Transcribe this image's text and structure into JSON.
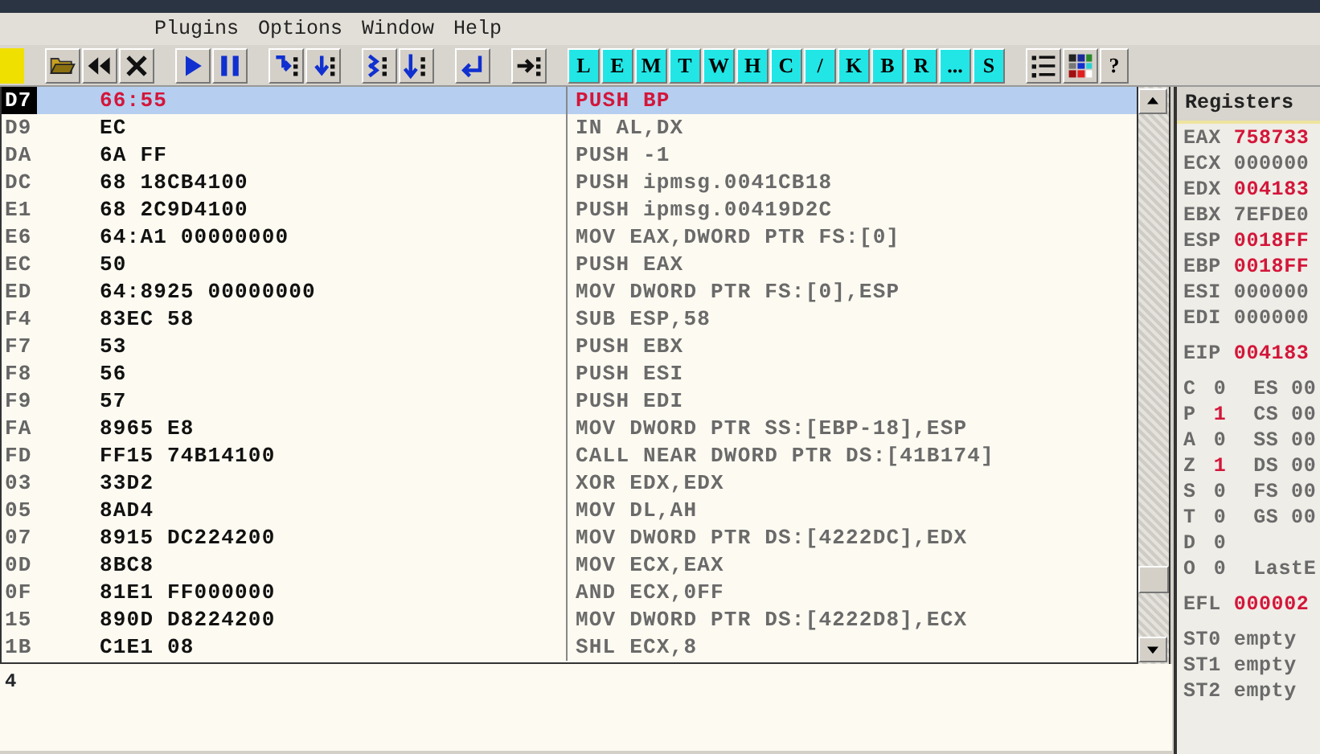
{
  "menu": [
    {
      "label": "Plugins"
    },
    {
      "label": "Options"
    },
    {
      "label": "Window"
    },
    {
      "label": "Help"
    }
  ],
  "toolbar": [
    {
      "kind": "marker"
    },
    {
      "kind": "gap"
    },
    {
      "kind": "folder"
    },
    {
      "kind": "rewind"
    },
    {
      "kind": "close"
    },
    {
      "kind": "gap"
    },
    {
      "kind": "play"
    },
    {
      "kind": "pause"
    },
    {
      "kind": "gap"
    },
    {
      "kind": "stepin"
    },
    {
      "kind": "stepover"
    },
    {
      "kind": "gap"
    },
    {
      "kind": "tracein"
    },
    {
      "kind": "traceover"
    },
    {
      "kind": "gap"
    },
    {
      "kind": "ret"
    },
    {
      "kind": "gap"
    },
    {
      "kind": "goto"
    },
    {
      "kind": "gap"
    },
    {
      "kind": "letter",
      "label": "L"
    },
    {
      "kind": "letter",
      "label": "E"
    },
    {
      "kind": "letter",
      "label": "M"
    },
    {
      "kind": "letter",
      "label": "T"
    },
    {
      "kind": "letter",
      "label": "W"
    },
    {
      "kind": "letter",
      "label": "H"
    },
    {
      "kind": "letter",
      "label": "C"
    },
    {
      "kind": "letter",
      "label": "/"
    },
    {
      "kind": "letter",
      "label": "K"
    },
    {
      "kind": "letter",
      "label": "B"
    },
    {
      "kind": "letter",
      "label": "R"
    },
    {
      "kind": "letter",
      "label": "..."
    },
    {
      "kind": "letter",
      "label": "S"
    },
    {
      "kind": "gap"
    },
    {
      "kind": "list"
    },
    {
      "kind": "palette"
    },
    {
      "kind": "text",
      "label": "?"
    }
  ],
  "disassembly": {
    "rows": [
      {
        "address": "D7",
        "hex": "66:55",
        "instruction": "PUSH BP",
        "selected": true,
        "modified": true
      },
      {
        "address": "D9",
        "hex": "EC",
        "instruction": "IN AL,DX",
        "selected": false,
        "modified": false
      },
      {
        "address": "DA",
        "hex": "6A FF",
        "instruction": "PUSH -1",
        "selected": false,
        "modified": false
      },
      {
        "address": "DC",
        "hex": "68 18CB4100",
        "instruction": "PUSH ipmsg.0041CB18",
        "selected": false,
        "modified": false
      },
      {
        "address": "E1",
        "hex": "68 2C9D4100",
        "instruction": "PUSH ipmsg.00419D2C",
        "selected": false,
        "modified": false
      },
      {
        "address": "E6",
        "hex": "64:A1 00000000",
        "instruction": "MOV EAX,DWORD PTR FS:[0]",
        "selected": false,
        "modified": false
      },
      {
        "address": "EC",
        "hex": "50",
        "instruction": "PUSH EAX",
        "selected": false,
        "modified": false
      },
      {
        "address": "ED",
        "hex": "64:8925 00000000",
        "instruction": "MOV DWORD PTR FS:[0],ESP",
        "selected": false,
        "modified": false
      },
      {
        "address": "F4",
        "hex": "83EC 58",
        "instruction": "SUB ESP,58",
        "selected": false,
        "modified": false
      },
      {
        "address": "F7",
        "hex": "53",
        "instruction": "PUSH EBX",
        "selected": false,
        "modified": false
      },
      {
        "address": "F8",
        "hex": "56",
        "instruction": "PUSH ESI",
        "selected": false,
        "modified": false
      },
      {
        "address": "F9",
        "hex": "57",
        "instruction": "PUSH EDI",
        "selected": false,
        "modified": false
      },
      {
        "address": "FA",
        "hex": "8965 E8",
        "instruction": "MOV DWORD PTR SS:[EBP-18],ESP",
        "selected": false,
        "modified": false
      },
      {
        "address": "FD",
        "hex": "FF15 74B14100",
        "instruction": "CALL NEAR DWORD PTR DS:[41B174]",
        "selected": false,
        "modified": false
      },
      {
        "address": "03",
        "hex": "33D2",
        "instruction": "XOR EDX,EDX",
        "selected": false,
        "modified": false
      },
      {
        "address": "05",
        "hex": "8AD4",
        "instruction": "MOV DL,AH",
        "selected": false,
        "modified": false
      },
      {
        "address": "07",
        "hex": "8915 DC224200",
        "instruction": "MOV DWORD PTR DS:[4222DC],EDX",
        "selected": false,
        "modified": false
      },
      {
        "address": "0D",
        "hex": "8BC8",
        "instruction": "MOV ECX,EAX",
        "selected": false,
        "modified": false
      },
      {
        "address": "0F",
        "hex": "81E1 FF000000",
        "instruction": "AND ECX,0FF",
        "selected": false,
        "modified": false
      },
      {
        "address": "15",
        "hex": "890D D8224200",
        "instruction": "MOV DWORD PTR DS:[4222D8],ECX",
        "selected": false,
        "modified": false
      },
      {
        "address": "1B",
        "hex": "C1E1 08",
        "instruction": "SHL ECX,8",
        "selected": false,
        "modified": false
      }
    ]
  },
  "info_pane": {
    "text": "4"
  },
  "registers": {
    "title": "Registers",
    "groups": [
      [
        {
          "name": "EAX",
          "value": "758733",
          "changed": true
        },
        {
          "name": "ECX",
          "value": "000000",
          "changed": false
        },
        {
          "name": "EDX",
          "value": "004183",
          "changed": true
        },
        {
          "name": "EBX",
          "value": "7EFDE0",
          "changed": false
        },
        {
          "name": "ESP",
          "value": "0018FF",
          "changed": true
        },
        {
          "name": "EBP",
          "value": "0018FF",
          "changed": true
        },
        {
          "name": "ESI",
          "value": "000000",
          "changed": false
        },
        {
          "name": "EDI",
          "value": "000000",
          "changed": false
        }
      ],
      [
        {
          "name": "EIP",
          "value": "004183",
          "changed": true
        }
      ],
      [
        {
          "name": "C",
          "value": "0",
          "changed": false,
          "extra": "ES 00"
        },
        {
          "name": "P",
          "value": "1",
          "changed": true,
          "extra": "CS 00"
        },
        {
          "name": "A",
          "value": "0",
          "changed": false,
          "extra": "SS 00"
        },
        {
          "name": "Z",
          "value": "1",
          "changed": true,
          "extra": "DS 00"
        },
        {
          "name": "S",
          "value": "0",
          "changed": false,
          "extra": "FS 00"
        },
        {
          "name": "T",
          "value": "0",
          "changed": false,
          "extra": "GS 00"
        },
        {
          "name": "D",
          "value": "0",
          "changed": false
        },
        {
          "name": "O",
          "value": "0",
          "changed": false,
          "extra": "LastE"
        }
      ],
      [
        {
          "name": "EFL",
          "value": "000002",
          "changed": true
        }
      ],
      [
        {
          "name": "ST0",
          "value": "empty",
          "changed": false
        },
        {
          "name": "ST1",
          "value": "empty",
          "changed": false
        },
        {
          "name": "ST2",
          "value": "empty",
          "changed": false
        }
      ]
    ]
  }
}
